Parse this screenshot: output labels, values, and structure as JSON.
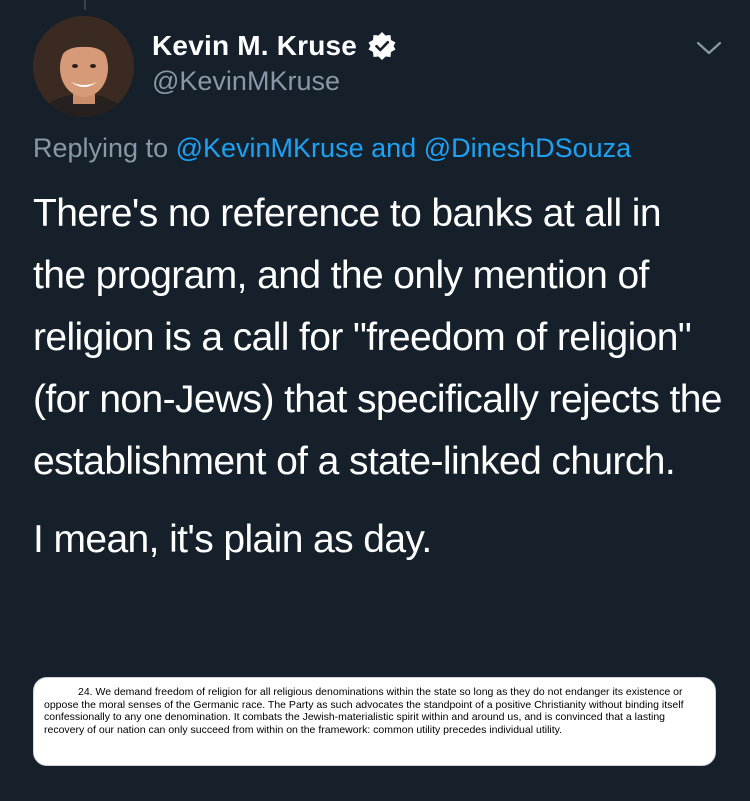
{
  "author": {
    "display_name": "Kevin M. Kruse",
    "handle": "@KevinMKruse",
    "verified": true
  },
  "reply_context": {
    "prefix": "Replying to",
    "mention_1": "@KevinMKruse",
    "joiner": "and",
    "mention_2": "@DineshDSouza"
  },
  "tweet": {
    "paragraph_1": "There's no reference to banks at all in the program, and the only mention of religion is a call for \"freedom of religion\" (for non-Jews) that specifically rejects the establishment of a state-linked church.",
    "paragraph_2": "I mean, it's plain as day."
  },
  "attached_image": {
    "text": "24. We demand freedom of religion for all religious denominations within the state so long as they do not endanger its existence or oppose the moral senses of the Germanic race. The Party as such advocates the standpoint of a positive Christianity without binding itself confessionally to any one denomination. It combats the Jewish-materialistic spirit within and around us, and is convinced that a lasting recovery of our nation can only succeed from within on the framework: common utility precedes individual utility."
  },
  "icons": {
    "verified": "verified-badge-icon",
    "more": "chevron-down-icon"
  },
  "colors": {
    "background": "#15202b",
    "primary_text": "#ffffff",
    "secondary_text": "#8899a6",
    "link": "#1da1f2"
  }
}
